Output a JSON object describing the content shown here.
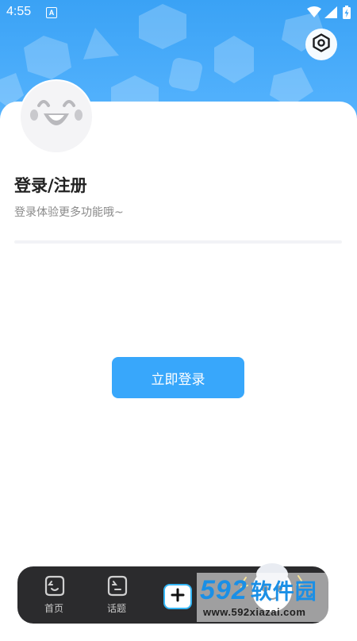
{
  "status_bar": {
    "time": "4:55",
    "notification_letter": "A",
    "icons": [
      "wifi-icon",
      "cell-signal-icon",
      "battery-icon"
    ]
  },
  "header": {
    "settings_icon": "settings-hexagon-icon"
  },
  "profile": {
    "avatar_icon": "laughing-face-icon",
    "title": "登录/注册",
    "subtitle": "登录体验更多功能哦~"
  },
  "login_button": {
    "label": "立即登录"
  },
  "tabbar": {
    "tabs": [
      {
        "label": "首页",
        "icon": "home-face-icon"
      },
      {
        "label": "话题",
        "icon": "topic-face-icon"
      }
    ],
    "add_icon": "plus-icon",
    "mascot_icon": "mascot-character-icon"
  },
  "watermark": {
    "logo_number": "592",
    "logo_text": "软件园",
    "url": "www.592xiazai.com"
  },
  "colors": {
    "header_blue": "#3aa2f5",
    "button_blue": "#38a7fb",
    "tabbar_dark": "#2b2b2d",
    "watermark_blue": "#1a8fe6"
  }
}
